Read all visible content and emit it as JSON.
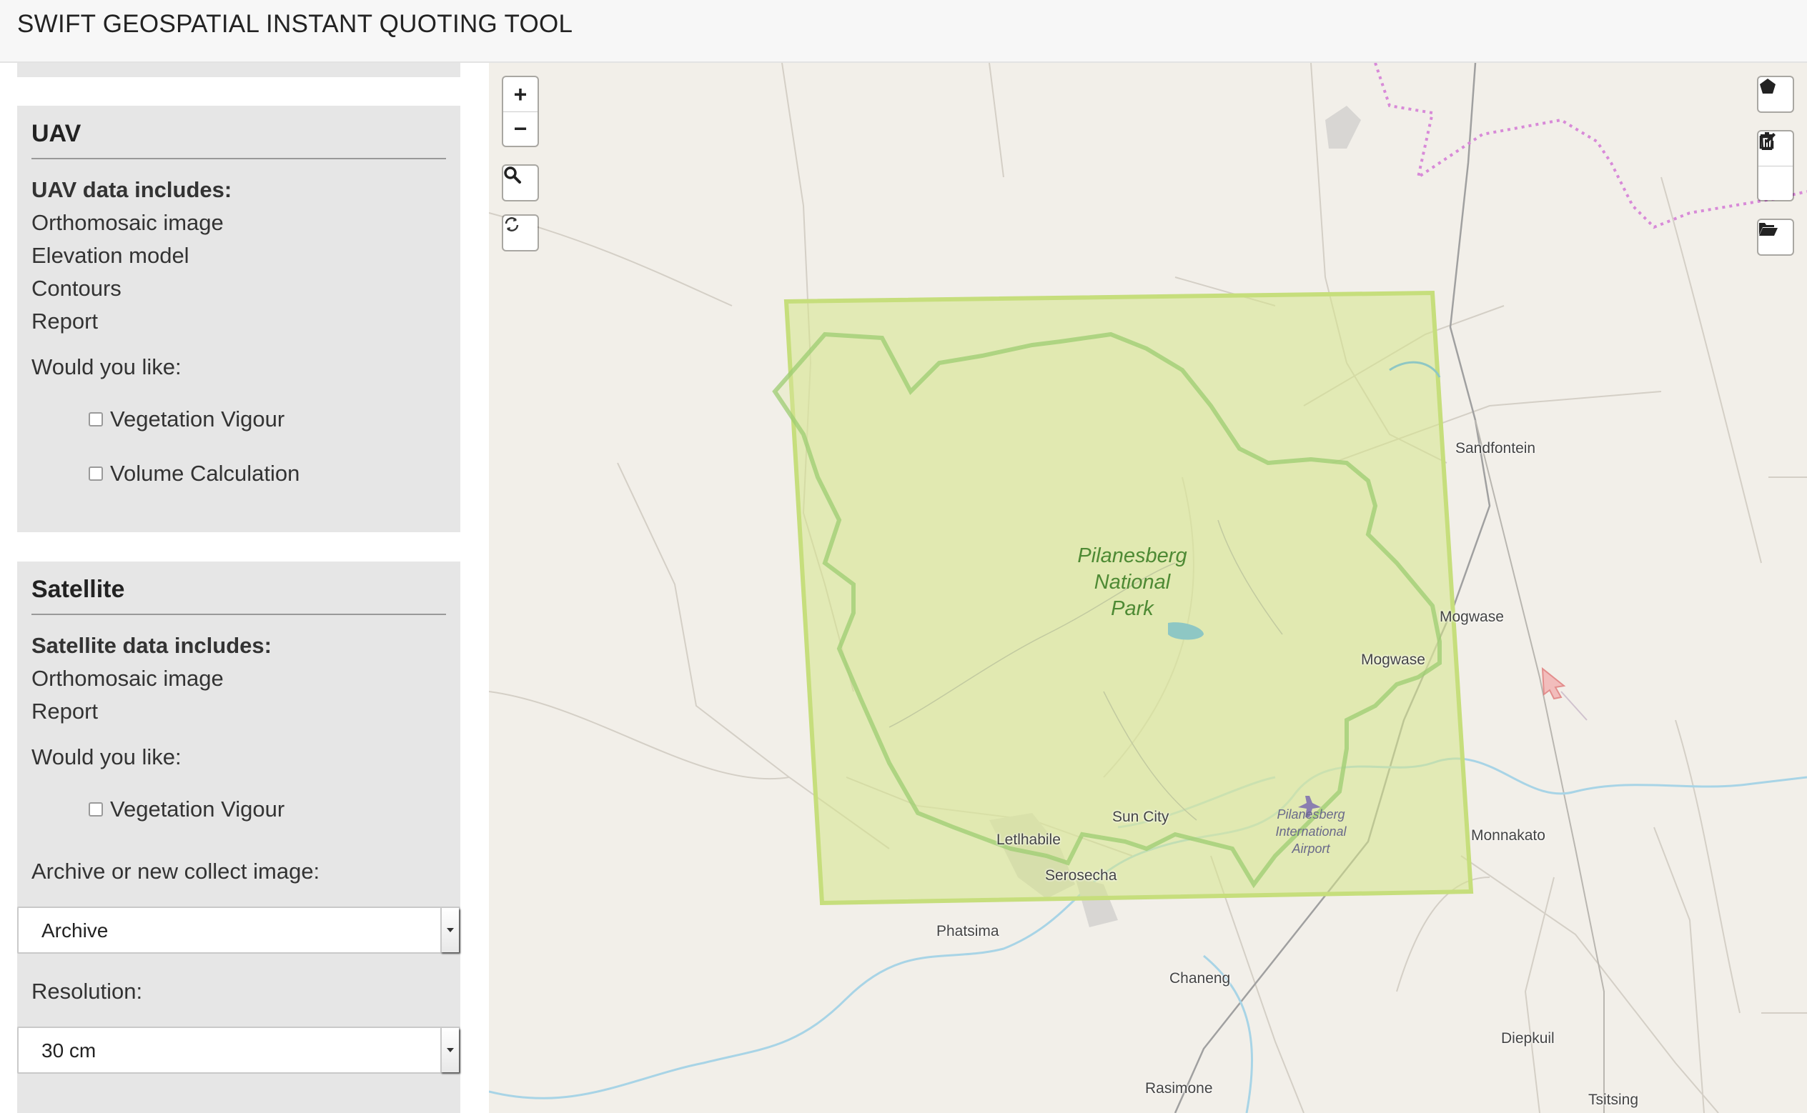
{
  "app": {
    "title": "SWIFT GEOSPATIAL INSTANT QUOTING TOOL"
  },
  "uav": {
    "heading": "UAV",
    "includes_label": "UAV data includes:",
    "items": [
      "Orthomosaic image",
      "Elevation model",
      "Contours",
      "Report"
    ],
    "prompt": "Would you like:",
    "options": [
      "Vegetation Vigour",
      "Volume Calculation"
    ]
  },
  "satellite": {
    "heading": "Satellite",
    "includes_label": "Satellite data includes:",
    "items": [
      "Orthomosaic image",
      "Report"
    ],
    "prompt": "Would you like:",
    "options": [
      "Vegetation Vigour"
    ],
    "archive_label": "Archive or new collect image:",
    "archive_value": "Archive",
    "resolution_label": "Resolution:",
    "resolution_value": "30 cm"
  },
  "map": {
    "controls": {
      "zoom_in": "+",
      "zoom_out": "−"
    },
    "park_name": "Pilanesberg National Park",
    "park_lines": [
      "Pilanesberg",
      "National",
      "Park"
    ],
    "airport_lines": [
      "Pilanesberg",
      "International",
      "Airport"
    ],
    "places": {
      "sandfontein": "Sandfontein",
      "mogwase_east": "Mogwase",
      "mogwase_west": "Mogwase",
      "sun_city": "Sun City",
      "letlhabile": "Letlhabile",
      "serosecha": "Serosecha",
      "phatsima": "Phatsima",
      "chaneng": "Chaneng",
      "monnakato": "Monnakato",
      "diepkuil": "Diepkuil",
      "rasimone": "Rasimone",
      "tsitsing": "Tsitsing"
    },
    "colors": {
      "selection_fill": "#d6e68a",
      "selection_stroke": "#c6de7c",
      "park_boundary": "#9ccc72",
      "river": "#a8d4e6",
      "border_dotted": "#d88ad8"
    }
  }
}
